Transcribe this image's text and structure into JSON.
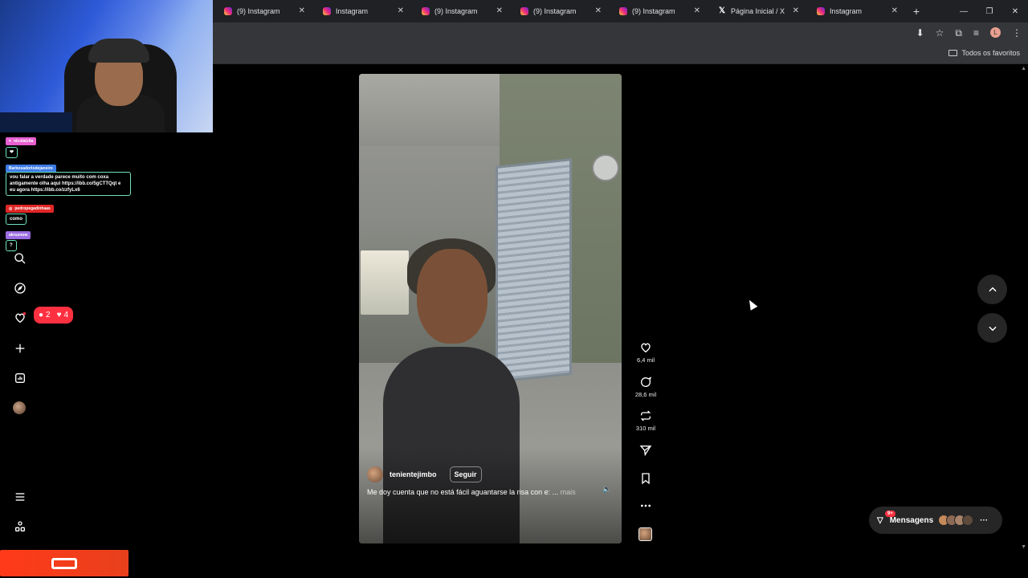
{
  "browser": {
    "tabs": [
      {
        "title": "(9) Instagram",
        "icon": "instagram-icon"
      },
      {
        "title": "Instagram",
        "icon": "instagram-icon"
      },
      {
        "title": "(9) Instagram",
        "icon": "instagram-icon"
      },
      {
        "title": "(9) Instagram",
        "icon": "instagram-icon"
      },
      {
        "title": "(9) Instagram",
        "icon": "instagram-icon"
      },
      {
        "title": "Página Inicial / X",
        "icon": "x-icon"
      },
      {
        "title": "Instagram",
        "icon": "instagram-icon"
      }
    ],
    "new_tab": "+",
    "bookmarks_folder": "Todos os favoritos",
    "profile_initial": "L"
  },
  "chat": [
    {
      "user": "nicolatzita",
      "message": "❤",
      "color": "#e85fd0"
    },
    {
      "user": "Barbosadorlodejaneiro",
      "message": "vou falar a verdade parece muito com coxa antigamente olha aqui https://ibb.co/5gCTTQqt e eu agora https://ibb.co/zzfyLx6",
      "color": "#3d7be6"
    },
    {
      "user": "pedropegadinhaas",
      "message": "como",
      "color": "#e02626"
    },
    {
      "user": "akrusnow",
      "message": "?",
      "color": "#9b6de0"
    }
  ],
  "notifications": {
    "comments": "2",
    "likes": "4"
  },
  "reel": {
    "username": "tenientejimbo",
    "follow_label": "Seguir",
    "caption": "Me doy cuenta que no está fácil aguantarse la risa con e: ...",
    "more_label": "mais",
    "likes": "6,4 mil",
    "comments": "28,6 mil",
    "reposts": "310 mil"
  },
  "messages": {
    "label": "Mensagens",
    "badge": "9+"
  },
  "colors": {
    "accent": "#ff3040",
    "surface": "#262626",
    "stream_brand": "#ff3a1a"
  }
}
